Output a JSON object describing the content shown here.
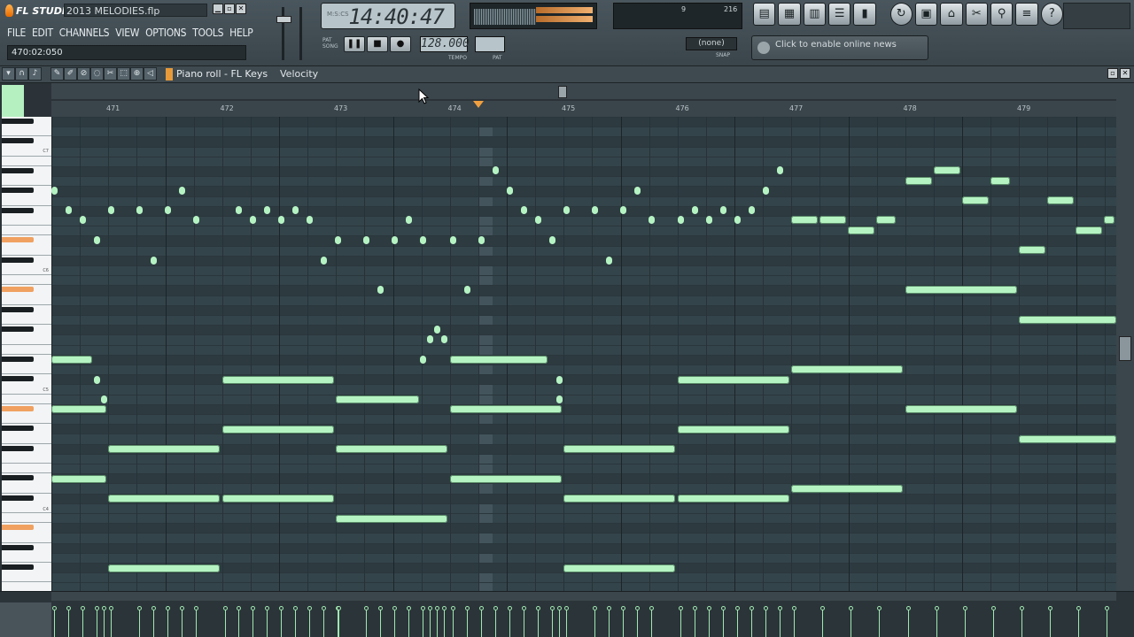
{
  "app": {
    "brand": "FL STUDIO",
    "file_title": "2013 MELODIES.flp",
    "menu": [
      "FILE",
      "EDIT",
      "CHANNELS",
      "VIEW",
      "OPTIONS",
      "TOOLS",
      "HELP"
    ],
    "hint_value": "470:02:050",
    "time_display": "14:40:47",
    "tempo": "128.000",
    "tempo_label": "TEMPO",
    "pat_label": "PAT",
    "snap_value": "(none)",
    "snap_label": "SNAP",
    "news_text": "Click to enable online news",
    "cpu": {
      "a": "9",
      "b": "216"
    }
  },
  "piano_roll": {
    "title": "Piano roll - FL Keys",
    "target": "Velocity",
    "bar_labels": [
      "471",
      "472",
      "473",
      "474",
      "475",
      "476",
      "477",
      "478",
      "479"
    ],
    "note_color": "#b5f3c3",
    "key_labels": [
      "C7",
      "C6",
      "C5",
      "C4"
    ]
  },
  "icons": {
    "logo": "fl-flame-icon",
    "toolbar": [
      "playlist-icon",
      "step-sequencer-icon",
      "piano-roll-icon",
      "browser-icon",
      "mixer-icon",
      "undo-icon",
      "save-icon",
      "record-icon",
      "cut-icon",
      "tools-icon",
      "project-info-icon",
      "help-icon"
    ]
  }
}
